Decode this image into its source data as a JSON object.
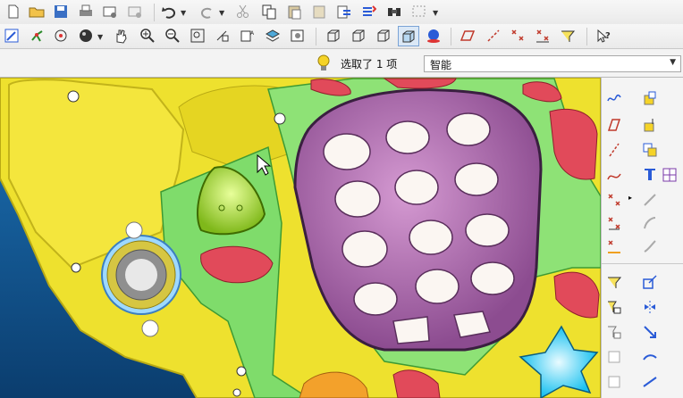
{
  "status": {
    "selected_text": "选取了 1 项"
  },
  "filter": {
    "value": "智能"
  },
  "icons": {
    "row1": [
      "new-file-icon",
      "open-folder-icon",
      "save-icon",
      "print-icon",
      "send-mail-icon",
      "mail-attach-icon",
      "undo-icon",
      "redo-icon",
      "cut-icon",
      "copy-icon",
      "paste-icon",
      "paste-special-icon",
      "regenerate-icon",
      "find-icon",
      "select-box-icon"
    ],
    "row2": [
      "edit-sketch-icon",
      "datum-axes-icon",
      "spin-center-icon",
      "shading-icon",
      "pan-hand-icon",
      "zoom-in-icon",
      "zoom-out-icon",
      "refit-icon",
      "reorient-icon",
      "saved-views-icon",
      "layers-icon",
      "wireframe-icon",
      "hidden-line-icon",
      "no-hidden-icon",
      "shaded-icon",
      "appearance-icon",
      "datum-plane-display-icon",
      "datum-axis-display-icon",
      "point-display-icon",
      "csys-display-icon",
      "annotation-display-icon",
      "context-help-icon"
    ],
    "right_panel": [
      "sketched-curve-icon",
      "datum-plane-icon",
      "datum-axis-icon",
      "datum-curve-icon",
      "datum-point-icon",
      "csys-icon",
      "analysis-icon",
      "extrude-icon",
      "revolve-icon",
      "sweep-icon",
      "blend-icon",
      "hole-icon",
      "shell-icon",
      "round-icon",
      "chamfer-icon",
      "draft-icon",
      "rib-icon",
      "pattern-icon",
      "mirror-icon",
      "trim-icon",
      "merge-icon",
      "offset-icon"
    ]
  }
}
